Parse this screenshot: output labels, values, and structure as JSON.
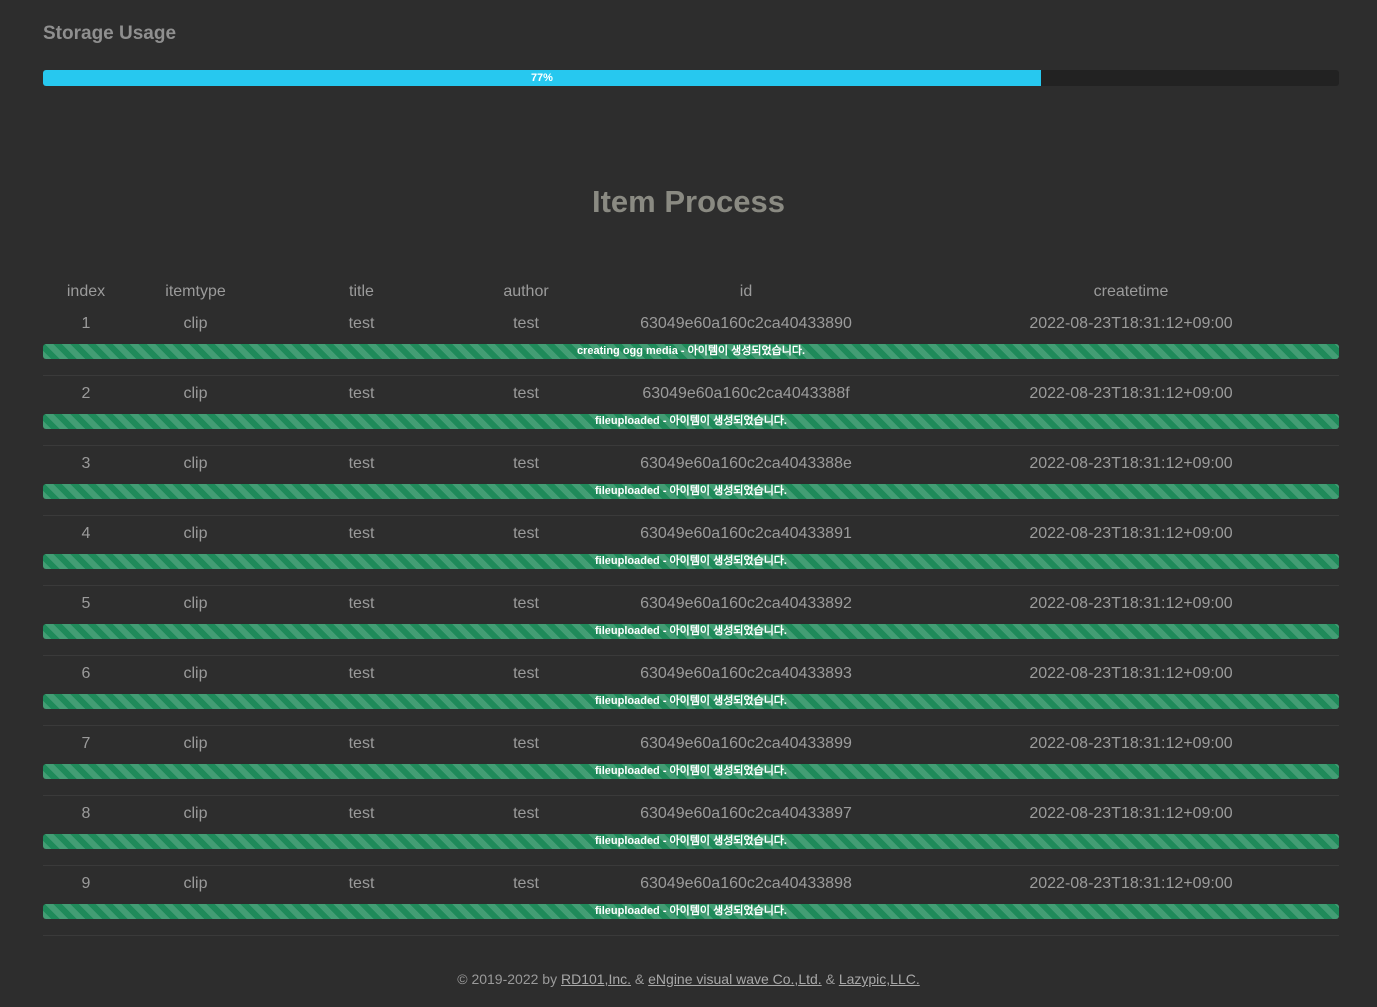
{
  "storage": {
    "title": "Storage Usage",
    "percent_label": "77%",
    "percent_value": 77,
    "bar_color": "#27c8ef"
  },
  "item_process": {
    "title": "Item Process",
    "columns": [
      "index",
      "itemtype",
      "title",
      "author",
      "id",
      "createtime"
    ],
    "rows": [
      {
        "index": "1",
        "itemtype": "clip",
        "title": "test",
        "author": "test",
        "id": "63049e60a160c2ca40433890",
        "createtime": "2022-08-23T18:31:12+09:00",
        "status": "creating ogg media - 아이템이 생성되었습니다."
      },
      {
        "index": "2",
        "itemtype": "clip",
        "title": "test",
        "author": "test",
        "id": "63049e60a160c2ca4043388f",
        "createtime": "2022-08-23T18:31:12+09:00",
        "status": "fileuploaded - 아이템이 생성되었습니다."
      },
      {
        "index": "3",
        "itemtype": "clip",
        "title": "test",
        "author": "test",
        "id": "63049e60a160c2ca4043388e",
        "createtime": "2022-08-23T18:31:12+09:00",
        "status": "fileuploaded - 아이템이 생성되었습니다."
      },
      {
        "index": "4",
        "itemtype": "clip",
        "title": "test",
        "author": "test",
        "id": "63049e60a160c2ca40433891",
        "createtime": "2022-08-23T18:31:12+09:00",
        "status": "fileuploaded - 아이템이 생성되었습니다."
      },
      {
        "index": "5",
        "itemtype": "clip",
        "title": "test",
        "author": "test",
        "id": "63049e60a160c2ca40433892",
        "createtime": "2022-08-23T18:31:12+09:00",
        "status": "fileuploaded - 아이템이 생성되었습니다."
      },
      {
        "index": "6",
        "itemtype": "clip",
        "title": "test",
        "author": "test",
        "id": "63049e60a160c2ca40433893",
        "createtime": "2022-08-23T18:31:12+09:00",
        "status": "fileuploaded - 아이템이 생성되었습니다."
      },
      {
        "index": "7",
        "itemtype": "clip",
        "title": "test",
        "author": "test",
        "id": "63049e60a160c2ca40433899",
        "createtime": "2022-08-23T18:31:12+09:00",
        "status": "fileuploaded - 아이템이 생성되었습니다."
      },
      {
        "index": "8",
        "itemtype": "clip",
        "title": "test",
        "author": "test",
        "id": "63049e60a160c2ca40433897",
        "createtime": "2022-08-23T18:31:12+09:00",
        "status": "fileuploaded - 아이템이 생성되었습니다."
      },
      {
        "index": "9",
        "itemtype": "clip",
        "title": "test",
        "author": "test",
        "id": "63049e60a160c2ca40433898",
        "createtime": "2022-08-23T18:31:12+09:00",
        "status": "fileuploaded - 아이템이 생성되었습니다."
      }
    ],
    "status_bar_color": "#1f8a5a"
  },
  "footer": {
    "prefix": "© 2019-2022 by ",
    "link1": "RD101,Inc.",
    "sep1": " & ",
    "link2": "eNgine visual wave Co.,Ltd.",
    "sep2": " & ",
    "link3": "Lazypic,LLC."
  }
}
